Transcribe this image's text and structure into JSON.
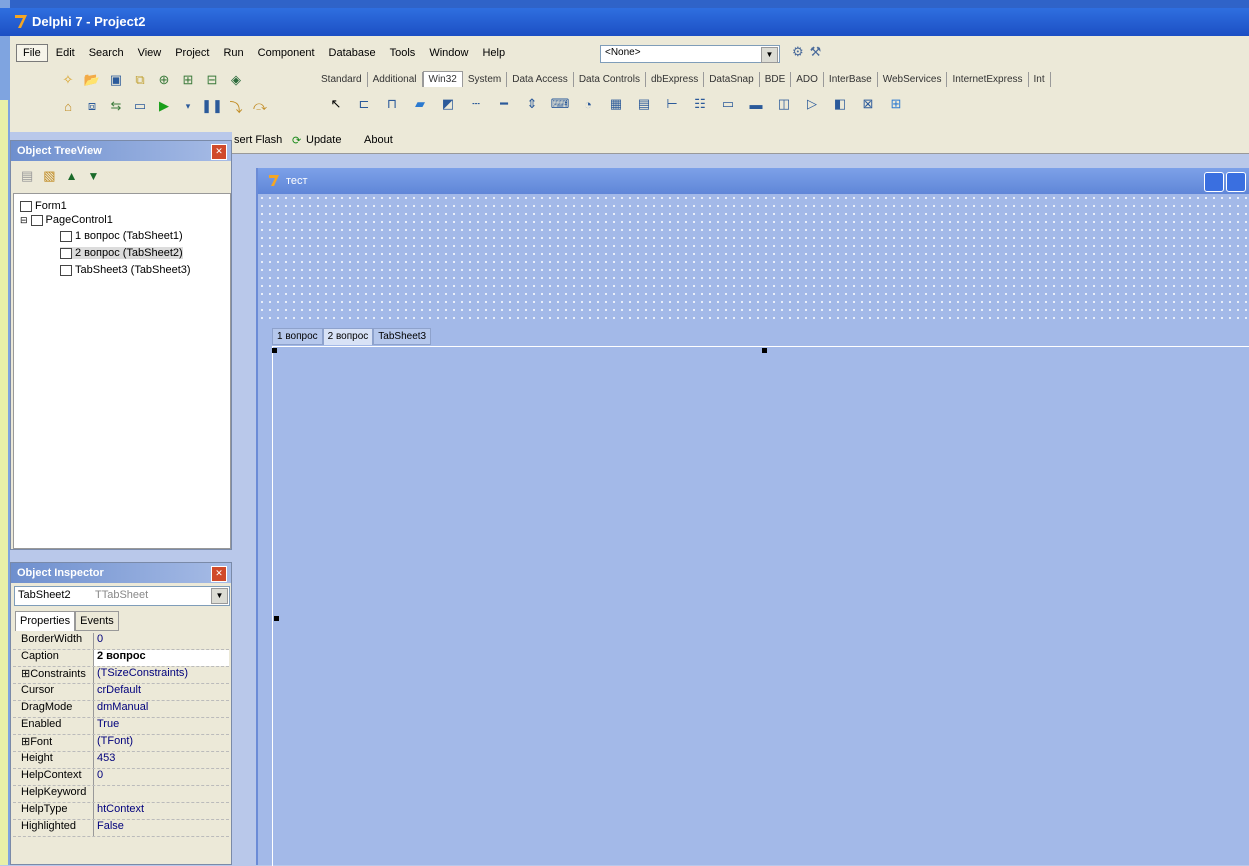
{
  "window": {
    "title": "Delphi 7 - Project2"
  },
  "menu": [
    "File",
    "Edit",
    "Search",
    "View",
    "Project",
    "Run",
    "Component",
    "Database",
    "Tools",
    "Window",
    "Help"
  ],
  "desktop_config": "<None>",
  "palette_tabs": [
    "Standard",
    "Additional",
    "Win32",
    "System",
    "Data Access",
    "Data Controls",
    "dbExpress",
    "DataSnap",
    "BDE",
    "ADO",
    "InterBase",
    "WebServices",
    "InternetExpress",
    "Int"
  ],
  "active_palette_tab": "Win32",
  "design_bar": {
    "insert_flash": "sert Flash",
    "update": "Update",
    "about": "About"
  },
  "treeview": {
    "title": "Object TreeView",
    "nodes": [
      "Form1",
      "PageControl1",
      "1 вопрос (TabSheet1)",
      "2 вопрос (TabSheet2)",
      "TabSheet3 (TabSheet3)"
    ]
  },
  "inspector": {
    "title": "Object Inspector",
    "object_name": "TabSheet2",
    "object_type": "TTabSheet",
    "tabs": [
      "Properties",
      "Events"
    ],
    "properties": [
      {
        "name": "BorderWidth",
        "value": "0"
      },
      {
        "name": "Caption",
        "value": "2 вопрос"
      },
      {
        "name": "⊞Constraints",
        "value": "(TSizeConstraints)"
      },
      {
        "name": "Cursor",
        "value": "crDefault"
      },
      {
        "name": "DragMode",
        "value": "dmManual"
      },
      {
        "name": "Enabled",
        "value": "True"
      },
      {
        "name": "⊞Font",
        "value": "(TFont)"
      },
      {
        "name": "Height",
        "value": "453"
      },
      {
        "name": "HelpContext",
        "value": "0"
      },
      {
        "name": "HelpKeyword",
        "value": ""
      },
      {
        "name": "HelpType",
        "value": "htContext"
      },
      {
        "name": "Highlighted",
        "value": "False"
      }
    ]
  },
  "form": {
    "title": "тест",
    "page_tabs": [
      "1 вопрос",
      "2 вопрос",
      "TabSheet3"
    ],
    "active_page_tab": "2 вопрос"
  },
  "colors": {
    "titlebar": "#1c4fc4",
    "form_bg": "#a3b9e8",
    "ide_bg": "#ece9d8"
  }
}
